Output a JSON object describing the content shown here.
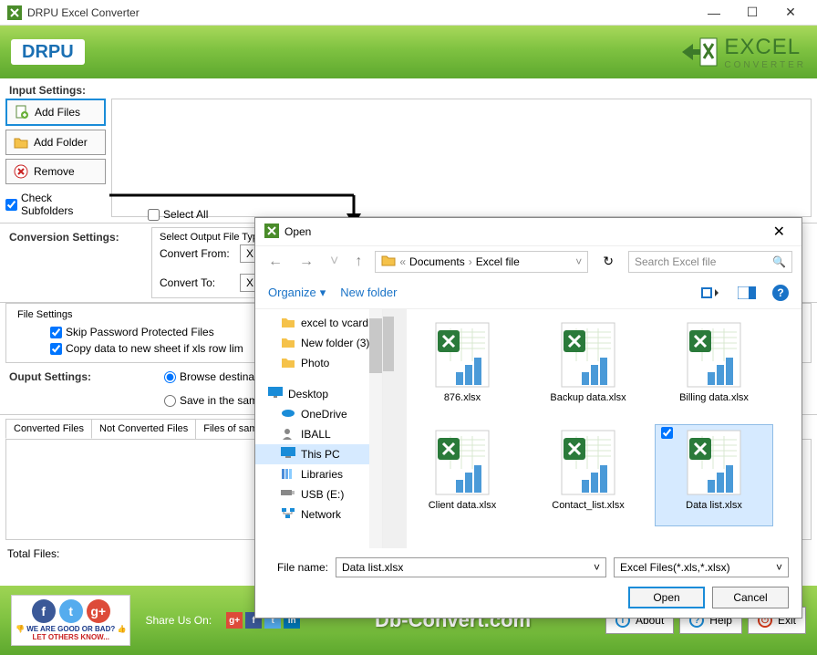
{
  "titlebar": {
    "title": "DRPU Excel Converter"
  },
  "header": {
    "logo": "DRPU",
    "product_line1": "EXCEL",
    "product_line2": "CONVERTER"
  },
  "input": {
    "heading": "Input Settings:",
    "add_files": "Add Files",
    "add_folder": "Add Folder",
    "remove": "Remove",
    "check_subfolders": "Check Subfolders",
    "select_all": "Select All"
  },
  "conversion": {
    "heading": "Conversion Settings:",
    "output_type_label": "Select Output File Type",
    "from_label": "Convert From:",
    "from_value": "XLSX",
    "to_label": "Convert To:",
    "to_value": "XLS",
    "fs_label": "File Settings",
    "skip_pw": "Skip Password Protected Files",
    "copy_data": "Copy data to new sheet if xls row lim"
  },
  "output": {
    "heading": "Ouput Settings:",
    "browse_dest": "Browse destination folde",
    "same_folder": "Save in the same folder"
  },
  "tabs": {
    "t1": "Converted Files",
    "t2": "Not Converted Files",
    "t3": "Files of same ext"
  },
  "total": "Total Files:",
  "bottom": {
    "rate_line1": "WE ARE GOOD OR BAD?",
    "rate_line2": "LET OTHERS KNOW...",
    "share": "Share Us On:",
    "db": "Db-Convert.com",
    "about": "About",
    "help": "Help",
    "exit": "Exit"
  },
  "dialog": {
    "title": "Open",
    "bc1": "Documents",
    "bc2": "Excel file",
    "search_ph": "Search Excel file",
    "organize": "Organize",
    "new_folder": "New folder",
    "tree": [
      "excel to vcard",
      "New folder (3)",
      "Photo",
      "Desktop",
      "OneDrive",
      "IBALL",
      "This PC",
      "Libraries",
      "USB (E:)",
      "Network"
    ],
    "files": [
      "876.xlsx",
      "Backup data.xlsx",
      "Billing data.xlsx",
      "Client data.xlsx",
      "Contact_list.xlsx",
      "Data list.xlsx"
    ],
    "selected_index": 5,
    "fname_label": "File name:",
    "fname_value": "Data list.xlsx",
    "filter": "Excel Files(*.xls,*.xlsx)",
    "open_btn": "Open",
    "cancel_btn": "Cancel"
  }
}
